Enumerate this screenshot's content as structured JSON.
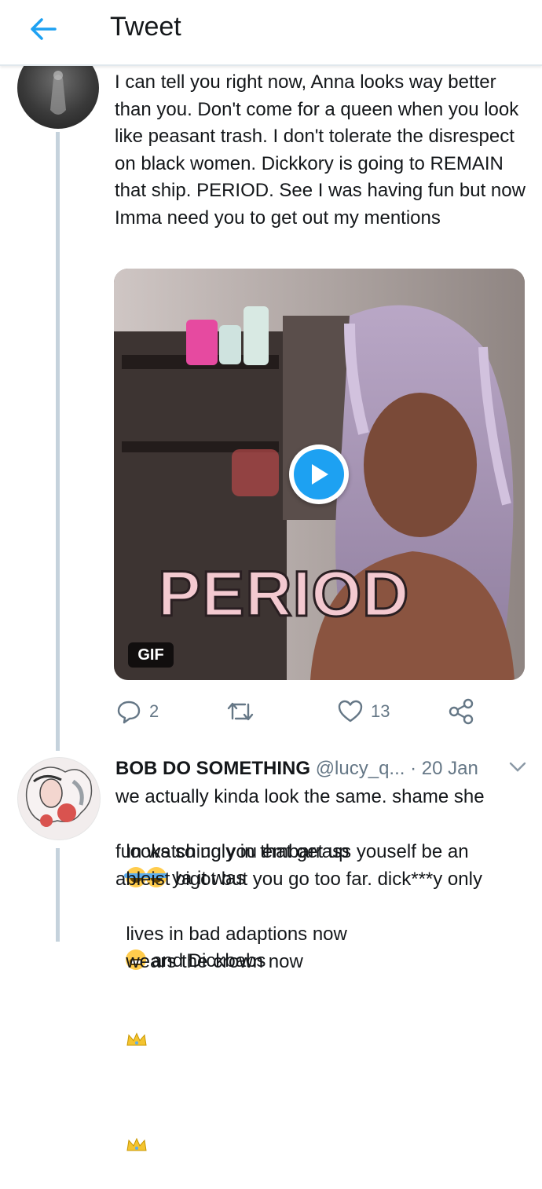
{
  "header": {
    "back_icon": "arrow-left-icon",
    "title": "Tweet",
    "accent": "#1da1f2"
  },
  "tweet": {
    "text": "I can tell you right now, Anna looks way better than you. Don't come for a queen when you look like peasant trash. I don't tolerate the disrespect on black women. Dickkory is going to REMAIN that ship. PERIOD. See I was having fun but now Imma need you to get out my mentions",
    "media": {
      "type": "GIF",
      "caption": "PERIOD",
      "badge": "GIF",
      "play_icon": "play-icon"
    },
    "actions": {
      "reply_icon": "reply-icon",
      "reply_count": "2",
      "retweet_icon": "retweet-icon",
      "like_icon": "heart-icon",
      "like_count": "13",
      "share_icon": "share-icon"
    }
  },
  "reply": {
    "name": "BOB DO SOMETHING",
    "handle": "@lucy_q...",
    "time": "· 20 Jan",
    "menu_icon": "chevron-down-icon",
    "lines": [
      "we actually kinda look the same. shame she",
      "looks so ugly in that get up",
      " ya it was",
      "fun watching you embarrass youself be an",
      "ableist bigot but you go too far. dick***y only",
      "lives in bad adaptions now",
      " and Dickbabs",
      "wears the crown now"
    ]
  }
}
